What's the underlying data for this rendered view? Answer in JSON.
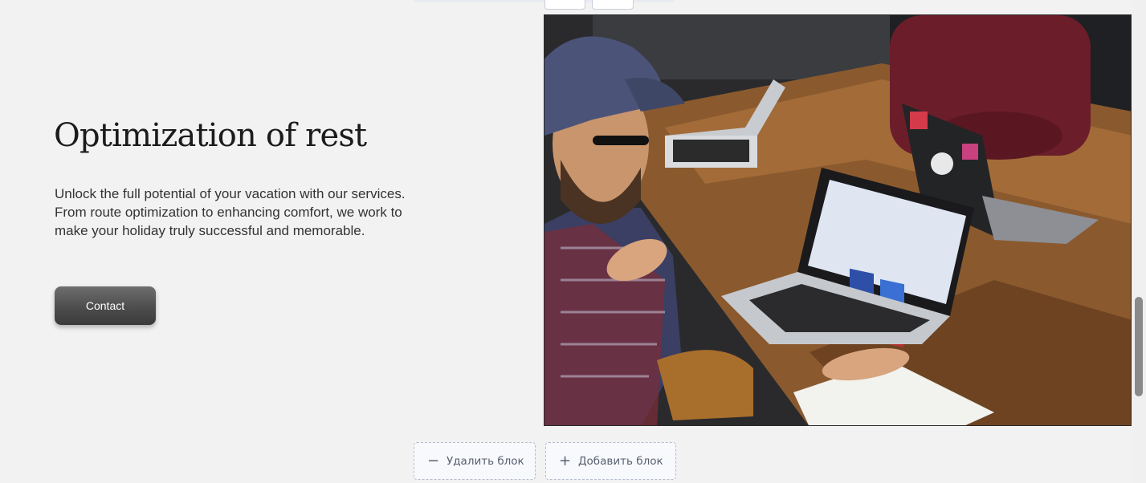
{
  "hero": {
    "title": "Optimization of rest",
    "description": "Unlock the full potential of your vacation with our services. From route optimization to enhancing comfort, we work to make your holiday truly successful and memorable.",
    "contact_label": "Contact",
    "image_alt": "team meeting with laptops at a wooden table"
  },
  "editor": {
    "delete_block_label": "Удалить блок",
    "add_block_label": "Добавить блок",
    "delete_icon": "minus-icon",
    "add_icon": "plus-icon"
  },
  "colors": {
    "background": "#f2f2f2",
    "button_gradient_top": "#6e6e6e",
    "button_gradient_bottom": "#3a3a3a",
    "editor_button_text": "#565f70"
  }
}
